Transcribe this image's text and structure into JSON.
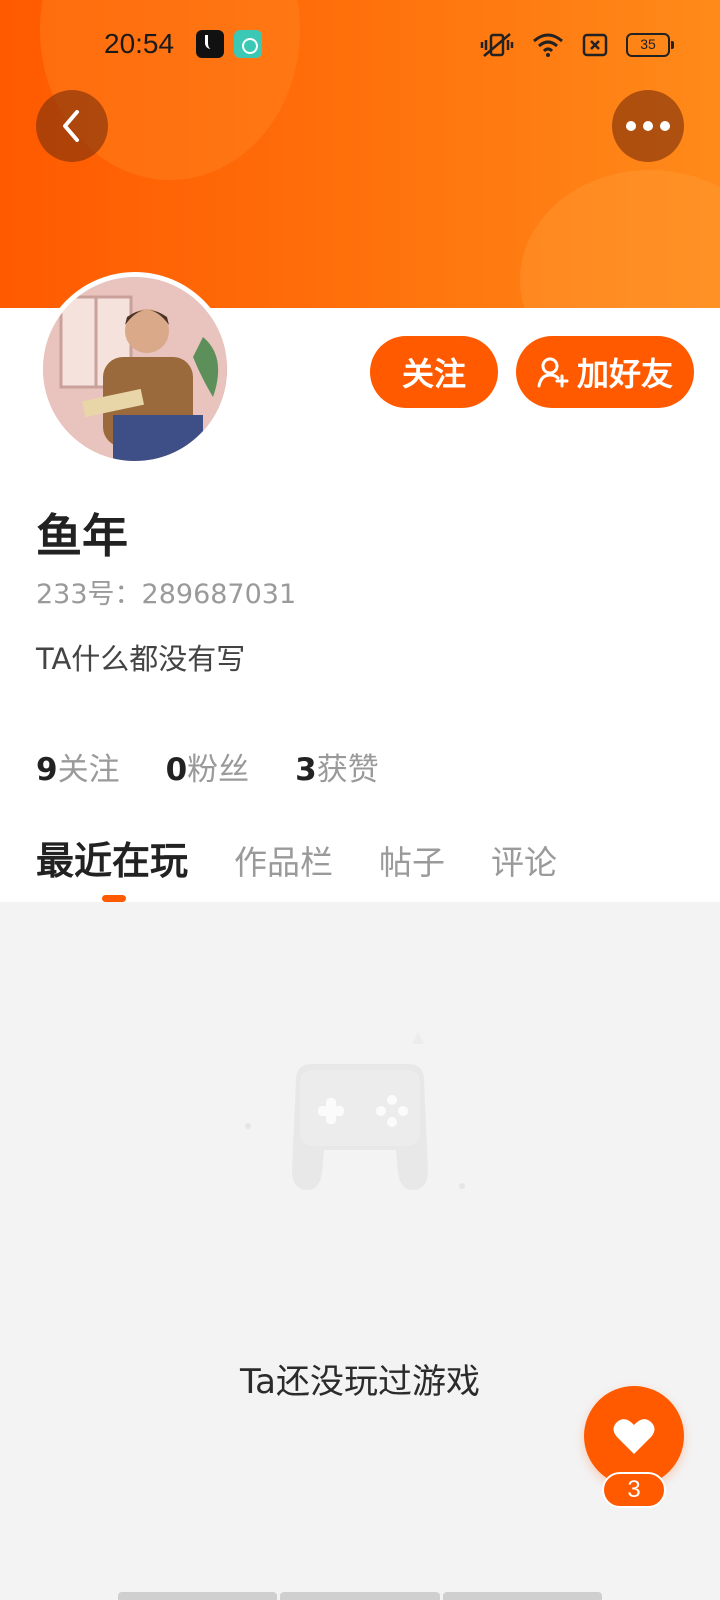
{
  "status_bar": {
    "time": "20:54",
    "battery": "35",
    "icons": [
      "tiktok-app-icon",
      "teal-app-icon",
      "vibrate-icon",
      "wifi-icon",
      "no-sim-icon",
      "battery-icon"
    ]
  },
  "header": {
    "back_icon": "chevron-left-icon",
    "more_icon": "more-dots-icon"
  },
  "profile": {
    "nickname": "鱼年",
    "uid": "233号：289687031",
    "bio": "TA什么都没有写",
    "follow_label": "关注",
    "add_friend_label": "加好友"
  },
  "stats": [
    {
      "num": "9",
      "label": "关注"
    },
    {
      "num": "0",
      "label": "粉丝"
    },
    {
      "num": "3",
      "label": "获赞"
    }
  ],
  "tabs": [
    {
      "label": "最近在玩",
      "active": true
    },
    {
      "label": "作品栏",
      "active": false
    },
    {
      "label": "帖子",
      "active": false
    },
    {
      "label": "评论",
      "active": false
    }
  ],
  "empty_state": {
    "icon": "gamepad-icon",
    "text": "Ta还没玩过游戏"
  },
  "fab": {
    "icon": "heart-icon",
    "count": "3"
  },
  "colors": {
    "accent": "#ff5a00",
    "banner_start": "#ff5a00",
    "banner_end": "#ff8a1a"
  }
}
